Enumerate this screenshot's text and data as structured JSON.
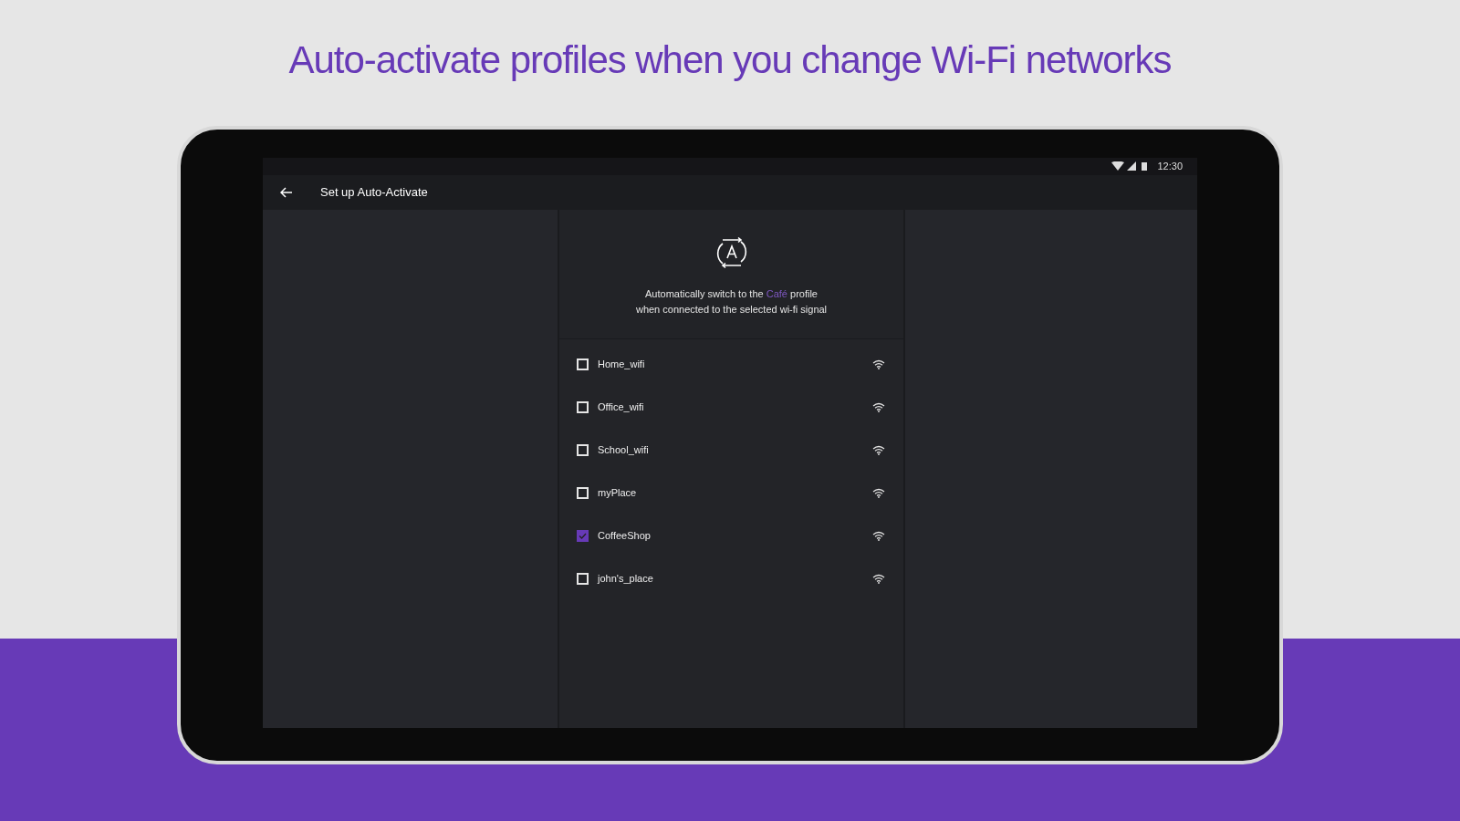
{
  "headline": "Auto-activate profiles when you change Wi-Fi networks",
  "status_bar": {
    "time": "12:30"
  },
  "app_bar": {
    "title": "Set up Auto-Activate"
  },
  "description": {
    "text_before": "Automatically switch to the",
    "profile": "Café",
    "text_after": "profile",
    "line_2": "when connected to the selected wi-fi signal"
  },
  "networks": [
    {
      "name": "Home_wifi",
      "checked": false
    },
    {
      "name": "Office_wifi",
      "checked": false
    },
    {
      "name": "School_wifi",
      "checked": false
    },
    {
      "name": "myPlace",
      "checked": false
    },
    {
      "name": "CoffeeShop",
      "checked": true
    },
    {
      "name": "john's_place",
      "checked": false
    }
  ]
}
